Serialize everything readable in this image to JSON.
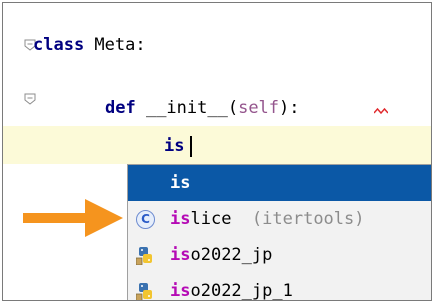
{
  "editor": {
    "class_keyword": "class",
    "class_rest": " Meta:",
    "def_keyword": "def",
    "func_name": " __init__(",
    "self_param": "self",
    "func_end": "):",
    "typed": "is"
  },
  "completion": {
    "items": [
      {
        "prefix": "is",
        "rest": "",
        "tail": "",
        "icon": "none",
        "selected": true
      },
      {
        "prefix": "is",
        "rest": "lice",
        "tail": "  (itertools)",
        "icon": "class-icon",
        "selected": false
      },
      {
        "prefix": "is",
        "rest": "o2022_jp",
        "tail": "",
        "icon": "python-module-icon",
        "selected": false
      },
      {
        "prefix": "is",
        "rest": "o2022_jp_1",
        "tail": "",
        "icon": "python-module-icon",
        "selected": false
      }
    ],
    "class_icon_letter": "C"
  },
  "colors": {
    "selection": "#0b58a6",
    "current_line": "#fcfad8",
    "arrow": "#f5941e",
    "match_highlight": "#b50ab5"
  }
}
